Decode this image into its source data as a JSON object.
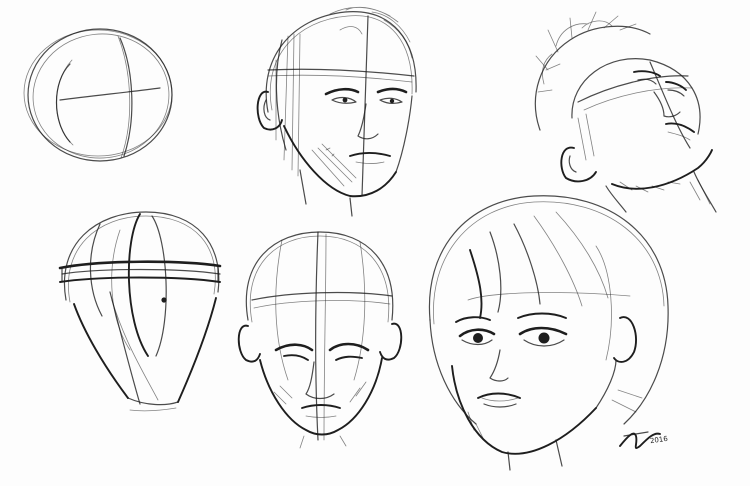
{
  "artwork": {
    "kind": "pencil head construction sketch sheet",
    "stroke_color": "#1e1e1e",
    "background_color": "#fdfdfd"
  },
  "signature": {
    "text": "",
    "year": "2016"
  }
}
